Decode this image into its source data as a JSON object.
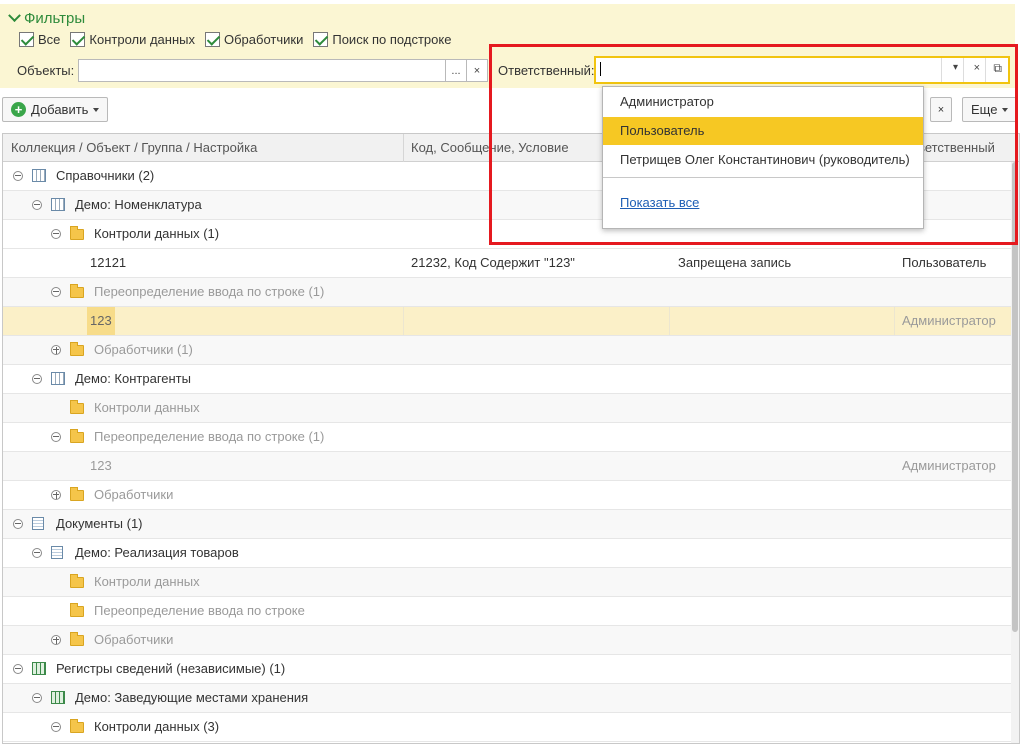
{
  "filters": {
    "title": "Фильтры",
    "checkboxes": [
      "Все",
      "Контроли данных",
      "Обработчики",
      "Поиск по подстроке"
    ],
    "objects_label": "Объекты:",
    "objects_value": "",
    "select_btn": "...",
    "clear_btn": "×",
    "responsible_label": "Ответственный:",
    "responsible_value": "",
    "dropdown_btn": "▾",
    "open_btn": "⧉"
  },
  "toolbar": {
    "add_label": "Добавить",
    "more_label": "Еще"
  },
  "table": {
    "headers": [
      "Коллекция / Объект / Группа / Настройка",
      "Код, Сообщение, Условие",
      "",
      "Ответственный"
    ],
    "rows": [
      {
        "label": "Справочники (2)"
      },
      {
        "label": "Демо: Номенклатура"
      },
      {
        "label": "Контроли данных (1)"
      },
      {
        "label": "12121",
        "code": "21232, Код Содержит \"123\"",
        "action": "Запрещена запись",
        "responsible": "Пользователь"
      },
      {
        "label": "Переопределение ввода по строке (1)"
      },
      {
        "label": "123",
        "responsible": "Администратор"
      },
      {
        "label": "Обработчики (1)"
      },
      {
        "label": "Демо: Контрагенты"
      },
      {
        "label": "Контроли данных"
      },
      {
        "label": "Переопределение ввода по строке (1)"
      },
      {
        "label": "123",
        "responsible": "Администратор"
      },
      {
        "label": "Обработчики"
      },
      {
        "label": "Документы (1)"
      },
      {
        "label": "Демо: Реализация товаров"
      },
      {
        "label": "Контроли данных"
      },
      {
        "label": "Переопределение ввода по строке"
      },
      {
        "label": "Обработчики"
      },
      {
        "label": "Регистры сведений (независимые) (1)"
      },
      {
        "label": "Демо: Заведующие местами хранения"
      },
      {
        "label": "Контроли данных (3)"
      }
    ]
  },
  "dropdown": {
    "items": [
      "Администратор",
      "Пользователь",
      "Петрищев Олег Константинович (руководитель)"
    ],
    "selected_index": 1,
    "show_all": "Показать все"
  },
  "colors": {
    "accent": "#2e8b3b",
    "filter_bg": "#fbf6d3",
    "selection": "#f6c823",
    "highlight": "#e5191f",
    "link": "#1d5eb5"
  }
}
